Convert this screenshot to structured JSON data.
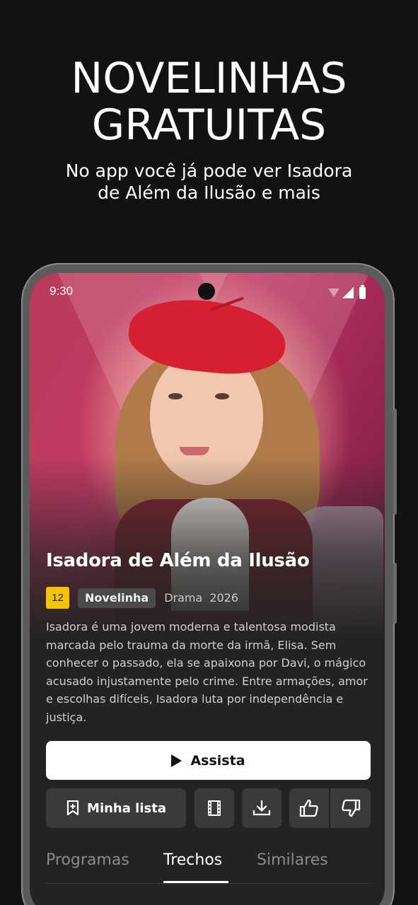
{
  "promo": {
    "title_line1": "NOVELINHAS",
    "title_line2": "GRATUITAS",
    "subtitle_line1": "No app você já pode ver Isadora",
    "subtitle_line2": "de Além da Ilusão e mais"
  },
  "statusbar": {
    "time": "9:30",
    "icons": [
      "wifi-icon",
      "signal-icon",
      "battery-icon"
    ]
  },
  "show": {
    "title": "Isadora de Além da Ilusão",
    "age_rating": "12",
    "genre_chip": "Novelinha",
    "genre": "Drama",
    "year": "2026",
    "synopsis": "Isadora é uma jovem moderna e talentosa modista marcada pelo trauma da morte da irmã, Elisa. Sem conhecer o passado, ela se apaixona por Davi, o mágico acusado injustamente pelo crime. Entre armações, amor e escolhas difíceis, Isadora luta por independência e justiça."
  },
  "actions": {
    "play_label": "Assista",
    "mylist_label": "Minha lista",
    "icons": [
      "bookmark-plus-icon",
      "film-icon",
      "download-icon",
      "thumbs-up-icon",
      "thumbs-down-icon"
    ]
  },
  "tabs": {
    "items": [
      "Programas",
      "Trechos",
      "Similares"
    ],
    "active": "Trechos"
  },
  "colors": {
    "background": "#121212",
    "age_badge": "#f5c400",
    "beret": "#d71f32",
    "hero_pink": "#c23a66"
  }
}
